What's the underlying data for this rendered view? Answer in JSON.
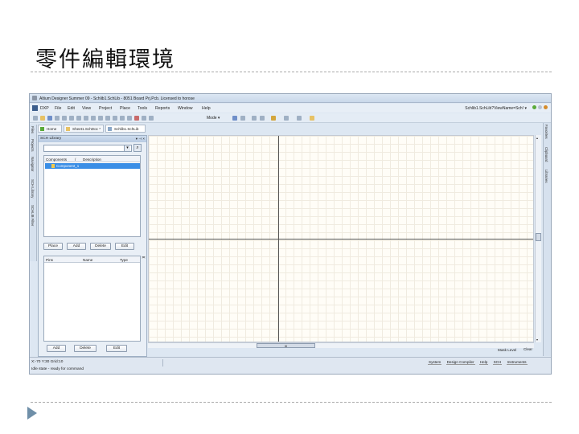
{
  "slide": {
    "title": "零件編輯環境"
  },
  "window": {
    "title": "Altium Designer Summer 09 - Schlib1.SchLib - 8051 Board Prj.Pcb. Licensed to horose"
  },
  "menubar": {
    "items": [
      "DXP",
      "File",
      "Edit",
      "View",
      "Project",
      "Place",
      "Tools",
      "Reports",
      "Window",
      "Help"
    ],
    "right_text": "Schlib1.SchLib?ViewName=Sch! ▾"
  },
  "toolbar": {
    "mode_label": "Mode ▾"
  },
  "doc_tabs": [
    "Home",
    "Sheet1.SchDoc *",
    "Schlib1.SchLib"
  ],
  "left_vtabs": [
    "Files",
    "Projects",
    "Navigator",
    "SCH Library",
    "SCHLIB Filter"
  ],
  "right_vtabs": [
    "Favorites",
    "Clipboard",
    "Libraries"
  ],
  "panel": {
    "title": "SCH Library",
    "pin_glyph": "▾ ⊣ ×",
    "filter_value": "",
    "components": {
      "headers": [
        "Components",
        "/",
        "Description"
      ],
      "rows": [
        {
          "name": "Component_1",
          "description": ""
        }
      ]
    },
    "comp_buttons": [
      "Place",
      "Add",
      "Delete",
      "Edit"
    ],
    "pins": {
      "headers": [
        "Pins",
        "Name",
        "Type"
      ]
    },
    "pin_buttons": [
      "Add",
      "Delete",
      "Edit"
    ]
  },
  "canvas": {
    "hscroll_thumb": "III"
  },
  "footer": {
    "mask_level": "Mask Level",
    "clear": "Clear",
    "coords": "X:-70 Y:30   Grid:10",
    "status": "Idle state - ready for command",
    "right_tabs": [
      "System",
      "Design Compiler",
      "Help",
      "SCH",
      "Instruments"
    ]
  },
  "colors": {
    "selection": "#3a8ee6",
    "canvas_bg": "#fffdf7",
    "grid": "#f0ebe0",
    "bullet": "#6f8fa8"
  }
}
